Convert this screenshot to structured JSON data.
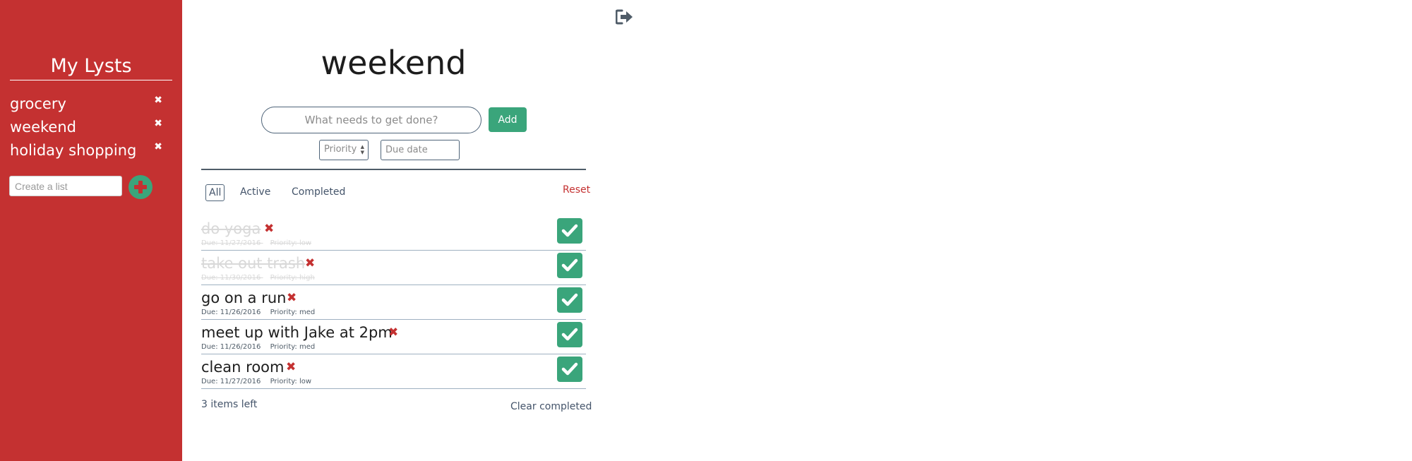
{
  "sidebar": {
    "title": "My Lysts",
    "lists": [
      {
        "label": "grocery",
        "delete_glyph": "✖"
      },
      {
        "label": "weekend",
        "delete_glyph": "✖"
      },
      {
        "label": "holiday shopping",
        "delete_glyph": "✖"
      }
    ],
    "create_placeholder": "Create a list",
    "create_icon": "plus-circle-icon"
  },
  "header": {
    "logout_icon": "sign-out-icon"
  },
  "main": {
    "title": "weekend",
    "todo_placeholder": "What needs to get done?",
    "add_label": "Add",
    "priority_label": "Priority",
    "due_placeholder": "Due date",
    "filters": {
      "all": "All",
      "active": "Active",
      "completed": "Completed"
    },
    "active_filter": "All",
    "reset_label": "Reset",
    "todos": [
      {
        "text": "do yoga",
        "due": "Due: 11/27/2016",
        "priority": "Priority: low",
        "done": true
      },
      {
        "text": "take out trash",
        "due": "Due: 11/30/2016",
        "priority": "Priority: high",
        "done": true
      },
      {
        "text": "go on a run",
        "due": "Due: 11/26/2016",
        "priority": "Priority: med",
        "done": false
      },
      {
        "text": "meet up with Jake at 2pm",
        "due": "Due: 11/26/2016",
        "priority": "Priority: med",
        "done": false
      },
      {
        "text": "clean room",
        "due": "Due: 11/27/2016",
        "priority": "Priority: low",
        "done": false
      }
    ],
    "delete_glyph": "✖",
    "items_left": "3 items left",
    "clear_completed": "Clear completed"
  },
  "colors": {
    "sidebar_bg": "#c43131",
    "accent_green": "#3aa57b",
    "danger_red": "#c43131",
    "text_slate": "#44546a"
  }
}
